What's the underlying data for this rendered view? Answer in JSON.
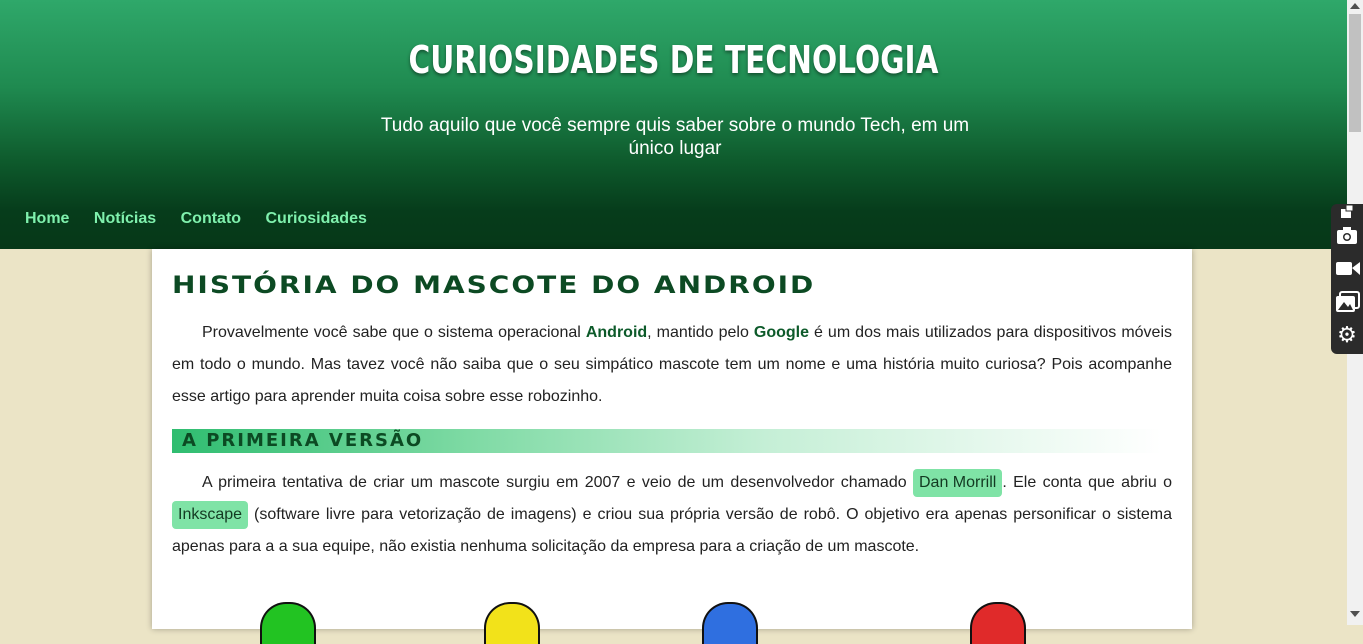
{
  "header": {
    "title": "CURIOSIDADES DE TECNOLOGIA",
    "subtitle": "Tudo aquilo que você sempre quis saber sobre o mundo Tech, em um único lugar"
  },
  "nav": {
    "items": [
      {
        "label": "Home"
      },
      {
        "label": "Notícias"
      },
      {
        "label": "Contato"
      },
      {
        "label": "Curiosidades"
      }
    ]
  },
  "article": {
    "title": "HISTÓRIA DO MASCOTE DO ANDROID",
    "intro": {
      "part1": "Provavelmente você sabe que o sistema operacional ",
      "bold1": "Android",
      "part2": ", mantido pelo ",
      "bold2": "Google",
      "part3": " é um dos mais utilizados para dispositivos móveis em todo o mundo. Mas tavez você não saiba que o seu simpático mascote tem um nome e uma história muito curiosa? Pois acompanhe esse artigo para aprender muita coisa sobre esse robozinho."
    },
    "section1": {
      "title": "A PRIMEIRA VERSÃO",
      "part1": "A primeira tentativa de criar um mascote surgiu em 2007 e veio de um desenvolvedor chamado ",
      "tag1": "Dan Morrill",
      "part2": ". Ele conta que abriu o ",
      "tag2": "Inkscape",
      "part3": " (software livre para vetorização de imagens) e criou sua própria versão de robô. O objetivo era apenas personificar o sistema apenas para a a sua equipe, não existia nenhuma solicitação da empresa para a criação de um mascote."
    }
  },
  "colors": {
    "header_top": "#2fa86a",
    "header_bottom": "#063818",
    "nav_link": "#7ff0ad",
    "page_bg": "#ebe4c6",
    "tag_bg": "#7fe3a6",
    "title_color": "#0c4a23"
  },
  "robots": [
    {
      "color": "#22c322"
    },
    {
      "color": "#f2e21a"
    },
    {
      "color": "#2f6fe0"
    },
    {
      "color": "#e02a2a"
    }
  ],
  "sidetool": {
    "icons": [
      "pin-icon",
      "camera-icon",
      "video-icon",
      "gallery-icon",
      "gear-icon"
    ]
  }
}
